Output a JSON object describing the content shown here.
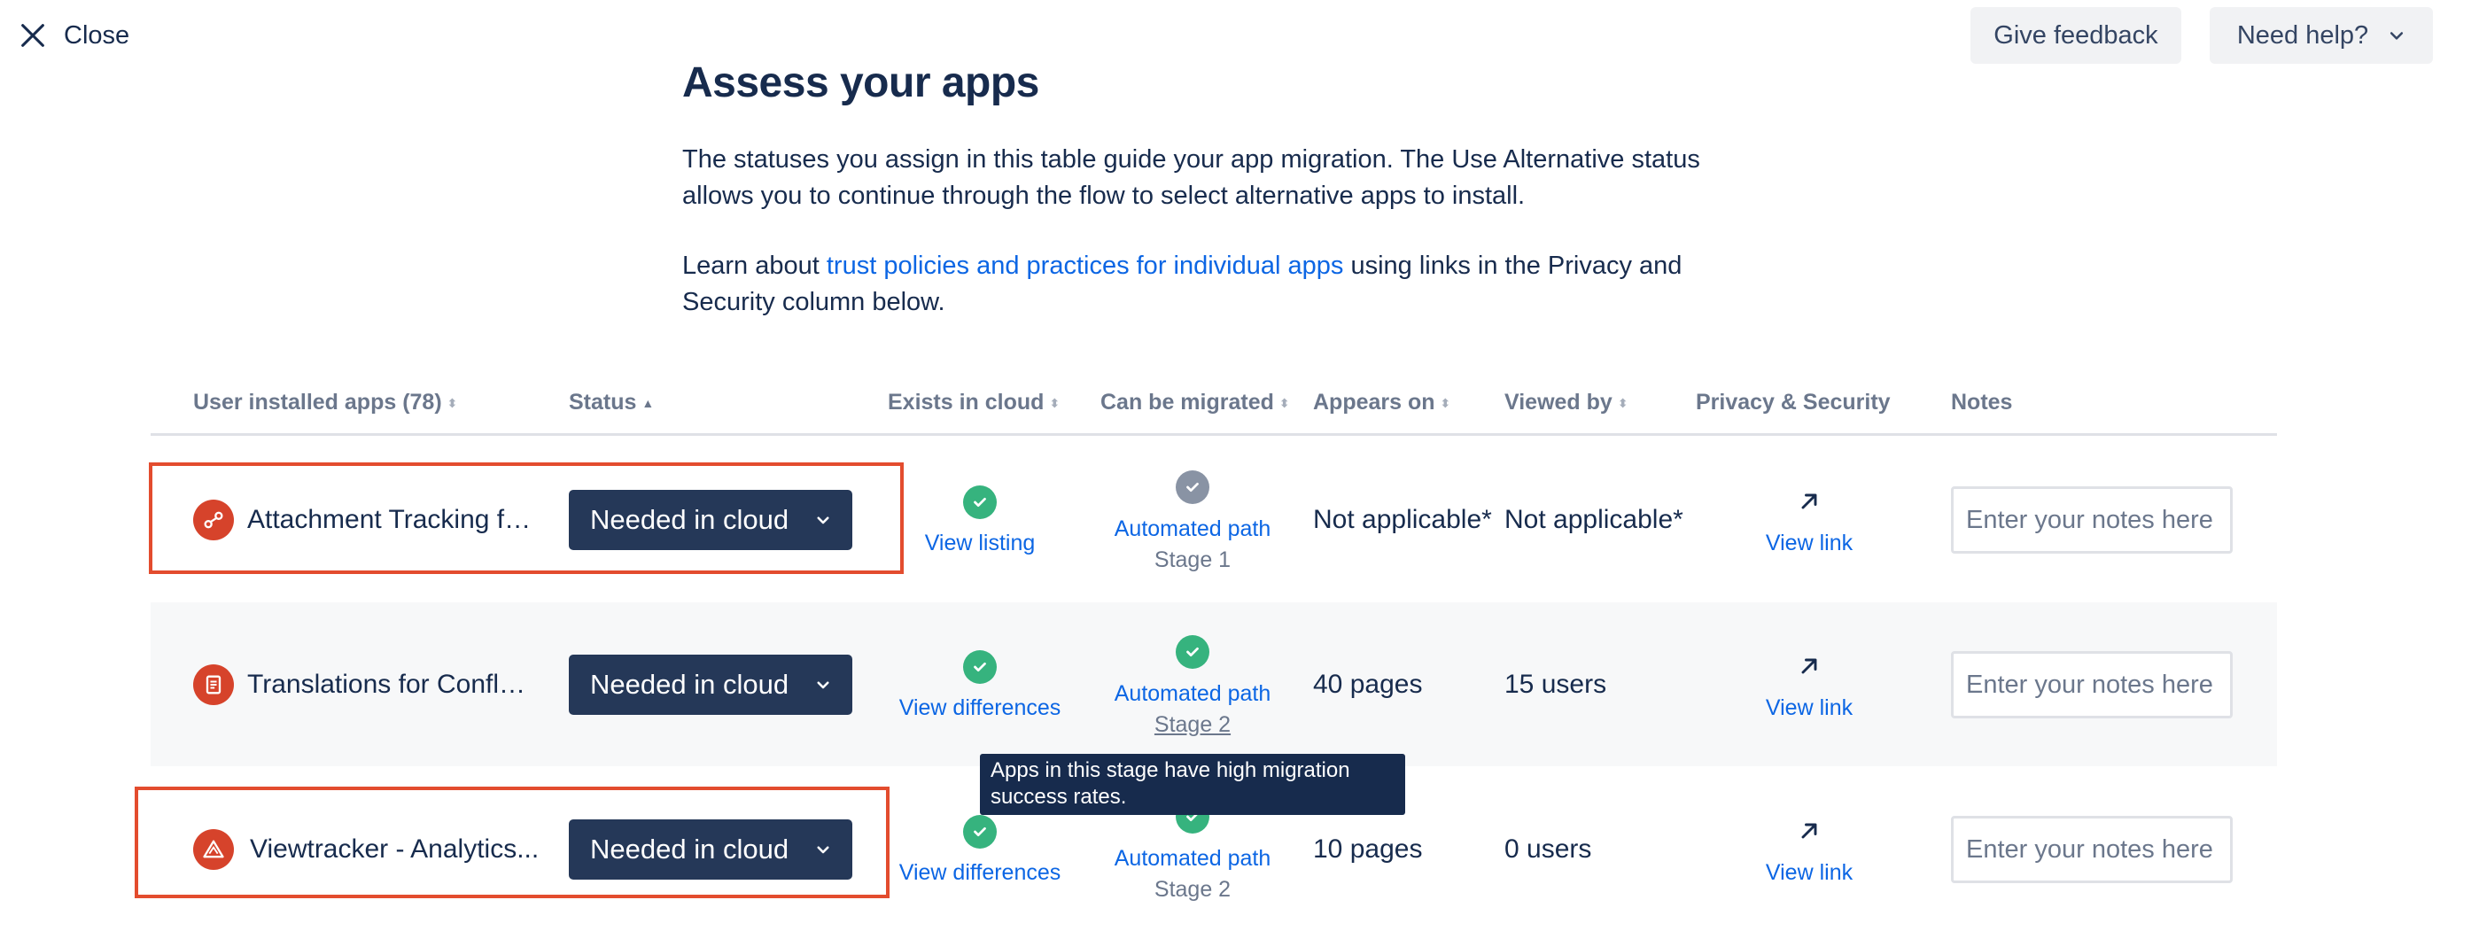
{
  "header": {
    "close_label": "Close",
    "feedback_label": "Give feedback",
    "help_label": "Need help?"
  },
  "intro": {
    "title": "Assess your apps",
    "paragraph1": "The statuses you assign in this table guide your app migration. The Use Alternative status allows you to continue through the flow to select alternative apps to install.",
    "paragraph2_prefix": "Learn about ",
    "paragraph2_link": "trust policies and practices for individual apps",
    "paragraph2_suffix": " using links in the Privacy and Security column below."
  },
  "table": {
    "columns": [
      "User installed apps (78)",
      "Status",
      "Exists in cloud",
      "Can be migrated",
      "Appears on",
      "Viewed by",
      "Privacy & Security",
      "Notes"
    ],
    "rows": [
      {
        "app": "Attachment Tracking fo...",
        "status": "Needed in cloud",
        "exists_link": "View listing",
        "migrate_link": "Automated path",
        "stage": "Stage 1",
        "appears_on": "Not applicable*",
        "viewed_by": "Not applicable*",
        "privacy_link": "View link",
        "notes_placeholder": "Enter your notes here"
      },
      {
        "app": "Translations for Conflue...",
        "status": "Needed in cloud",
        "exists_link": "View differences",
        "migrate_link": "Automated path",
        "stage": "Stage 2",
        "appears_on": "40 pages",
        "viewed_by": "15 users",
        "privacy_link": "View link",
        "notes_placeholder": "Enter your notes here"
      },
      {
        "app": "Viewtracker - Analytics...",
        "status": "Needed in cloud",
        "exists_link": "View differences",
        "migrate_link": "Automated path",
        "stage": "Stage 2",
        "appears_on": "10 pages",
        "viewed_by": "0 users",
        "privacy_link": "View link",
        "notes_placeholder": "Enter your notes here"
      }
    ]
  },
  "tooltip": {
    "text": "Apps in this stage have high migration success rates."
  },
  "colors": {
    "status_button": "#253858",
    "link": "#0c66e4",
    "check_green": "#36b37e",
    "check_grey": "#8993a4",
    "app_icon": "#d6432b",
    "highlight": "#e34c2e",
    "tooltip_bg": "#172b4d"
  },
  "icons": {
    "close": "close-icon",
    "chevron": "chevron-down-icon",
    "check": "check-circle-icon",
    "external": "external-arrow-icon"
  }
}
